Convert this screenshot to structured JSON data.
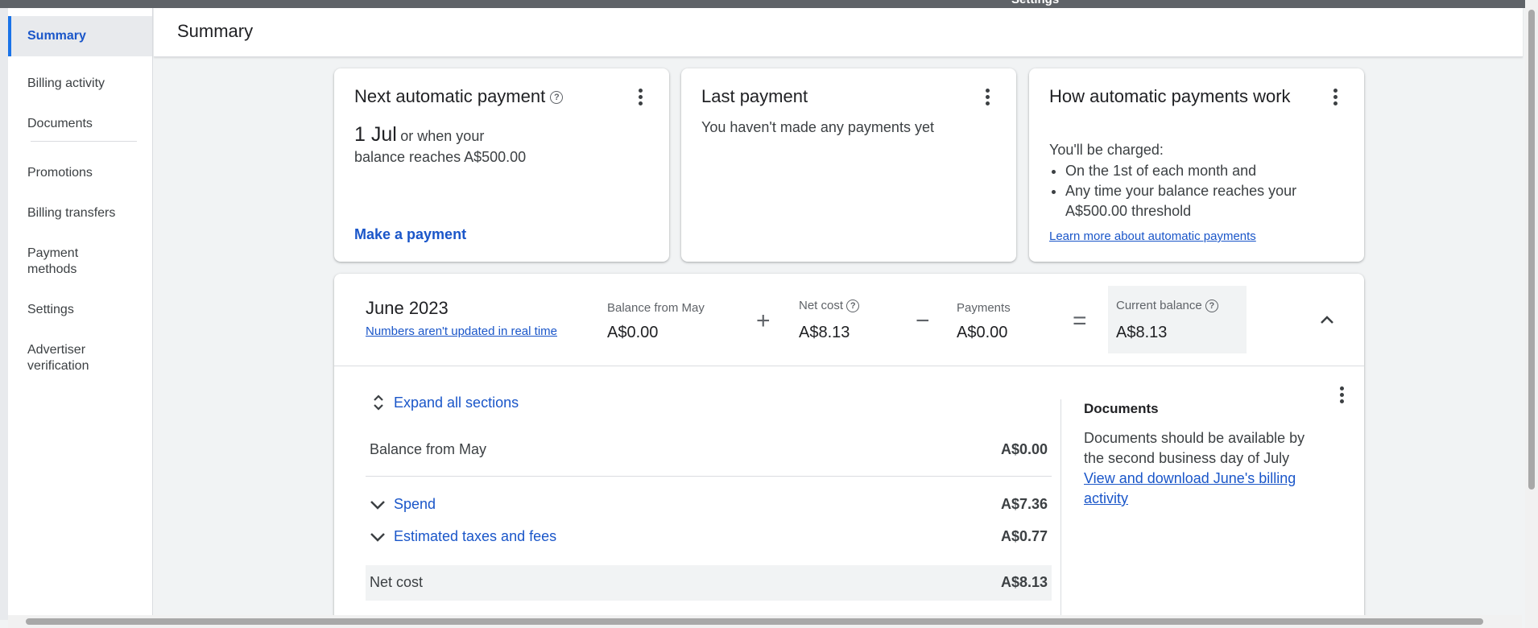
{
  "window": {
    "title": "Settings"
  },
  "header": {
    "title": "Summary"
  },
  "sidebar": {
    "items": [
      {
        "label": "Summary"
      },
      {
        "label": "Billing activity"
      },
      {
        "label": "Documents"
      },
      {
        "label": "Promotions"
      },
      {
        "label": "Billing transfers"
      },
      {
        "label": "Payment methods"
      },
      {
        "label": "Settings"
      },
      {
        "label": "Advertiser verification"
      }
    ]
  },
  "cards": {
    "next_payment": {
      "title": "Next automatic payment",
      "date": "1 Jul",
      "line1": "or when your",
      "line2": "balance reaches A$500.00",
      "action": "Make a payment"
    },
    "last_payment": {
      "title": "Last payment",
      "text": "You haven't made any payments yet"
    },
    "how_it_works": {
      "title": "How automatic payments work",
      "intro": "You'll be charged:",
      "bullets": [
        "On the 1st of each month and",
        "Any time your balance reaches your A$500.00 threshold"
      ],
      "link": "Learn more about automatic payments"
    }
  },
  "period": {
    "title": "June 2023",
    "note": "Numbers aren't updated in real time",
    "balance_from_label": "Balance from May",
    "balance_from_value": "A$0.00",
    "net_cost_label": "Net cost",
    "net_cost_value": "A$8.13",
    "payments_label": "Payments",
    "payments_value": "A$0.00",
    "current_balance_label": "Current balance",
    "current_balance_value": "A$8.13",
    "ops": {
      "plus": "+",
      "minus": "−",
      "equals": "="
    }
  },
  "details": {
    "expand_all": "Expand all sections",
    "rows": [
      {
        "label": "Balance from May",
        "value": "A$0.00"
      },
      {
        "label": "Spend",
        "value": "A$7.36"
      },
      {
        "label": "Estimated taxes and fees",
        "value": "A$0.77"
      },
      {
        "label": "Net cost",
        "value": "A$8.13"
      }
    ]
  },
  "documents": {
    "title": "Documents",
    "text": "Documents should be available by the second business day of July",
    "link": "View and download June's billing activity"
  }
}
